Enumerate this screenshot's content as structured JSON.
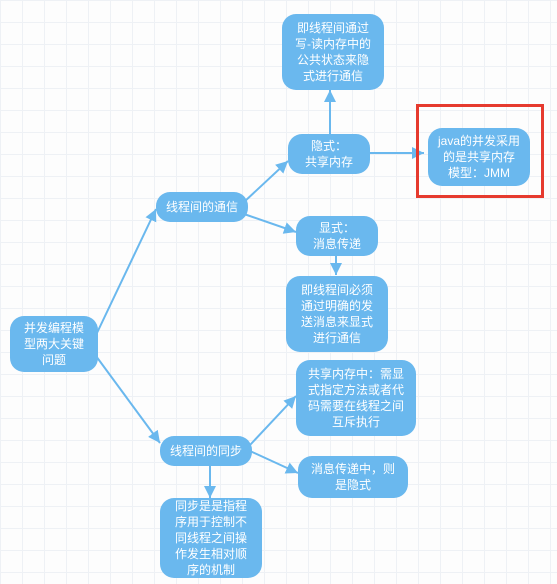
{
  "diagram": {
    "root": "并发编程模型两大关键问题",
    "branch_comm": "线程间的通信",
    "branch_sync": "线程间的同步",
    "comm_implicit": "隐式：\n共享内存",
    "comm_explicit": "显式：\n消息传递",
    "comm_implicit_detail": "即线程间通过写-读内存中的公共状态来隐式进行通信",
    "comm_implicit_java": "java的并发采用的是共享内存模型：JMM",
    "comm_explicit_detail": "即线程间必须通过明确的发送消息来显式进行通信",
    "sync_shared_mem": "共享内存中：需显式指定方法或者代码需要在线程之间互斥执行",
    "sync_msg_pass": "消息传递中，则是隐式",
    "sync_def": "同步是是指程序用于控制不同线程之间操作发生相对顺序的机制"
  }
}
